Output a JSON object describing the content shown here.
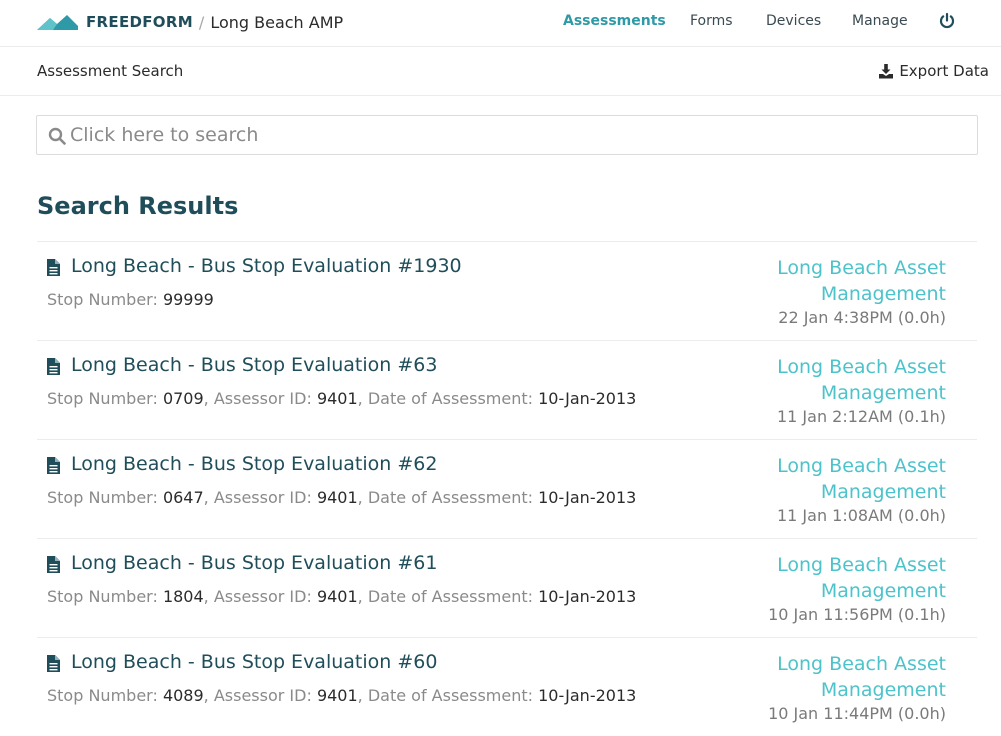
{
  "navbar": {
    "brand_name": "FREEDFORM",
    "separator": "/",
    "project": "Long Beach AMP",
    "links": [
      {
        "label": "Assessments",
        "active": true
      },
      {
        "label": "Forms",
        "active": false
      },
      {
        "label": "Devices",
        "active": false
      },
      {
        "label": "Manage",
        "active": false
      }
    ],
    "power_icon": "power-icon"
  },
  "subheader": {
    "title": "Assessment Search",
    "export_label": "Export Data",
    "export_icon": "download-icon"
  },
  "search": {
    "placeholder": "Click here to search",
    "value": "",
    "icon": "search-icon"
  },
  "results": {
    "heading": "Search Results",
    "items": [
      {
        "title": "Long Beach - Bus Stop Evaluation #1930",
        "fields": [
          {
            "label": "Stop Number:",
            "value": "99999"
          }
        ],
        "org": "Long Beach Asset Management",
        "time": "22 Jan 4:38PM (0.0h)"
      },
      {
        "title": "Long Beach - Bus Stop Evaluation #63",
        "fields": [
          {
            "label": "Stop Number:",
            "value": "0709"
          },
          {
            "label": "Assessor ID:",
            "value": "9401"
          },
          {
            "label": "Date of Assessment:",
            "value": "10-Jan-2013"
          }
        ],
        "org": "Long Beach Asset Management",
        "time": "11 Jan 2:12AM (0.1h)"
      },
      {
        "title": "Long Beach - Bus Stop Evaluation #62",
        "fields": [
          {
            "label": "Stop Number:",
            "value": "0647"
          },
          {
            "label": "Assessor ID:",
            "value": "9401"
          },
          {
            "label": "Date of Assessment:",
            "value": "10-Jan-2013"
          }
        ],
        "org": "Long Beach Asset Management",
        "time": "11 Jan 1:08AM (0.0h)"
      },
      {
        "title": "Long Beach - Bus Stop Evaluation #61",
        "fields": [
          {
            "label": "Stop Number:",
            "value": "1804"
          },
          {
            "label": "Assessor ID:",
            "value": "9401"
          },
          {
            "label": "Date of Assessment:",
            "value": "10-Jan-2013"
          }
        ],
        "org": "Long Beach Asset Management",
        "time": "10 Jan 11:56PM (0.1h)"
      },
      {
        "title": "Long Beach - Bus Stop Evaluation #60",
        "fields": [
          {
            "label": "Stop Number:",
            "value": "4089"
          },
          {
            "label": "Assessor ID:",
            "value": "9401"
          },
          {
            "label": "Date of Assessment:",
            "value": "10-Jan-2013"
          }
        ],
        "org": "Long Beach Asset Management",
        "time": "10 Jan 11:44PM (0.0h)"
      }
    ]
  },
  "colors": {
    "brand": "#1f4e5a",
    "accent": "#2f9aa7",
    "org_link": "#4cc3cb"
  }
}
